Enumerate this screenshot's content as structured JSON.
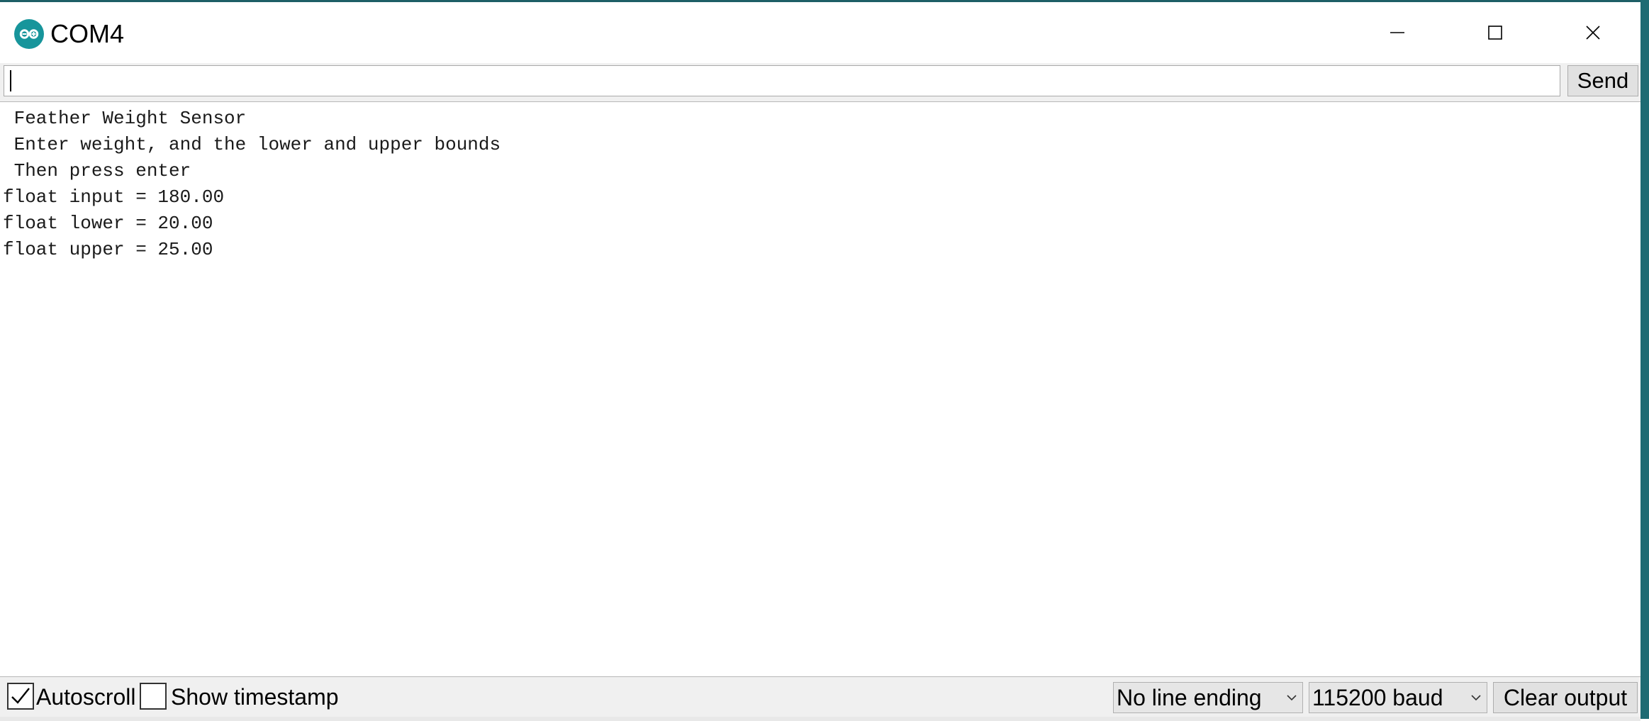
{
  "window": {
    "title": "COM4",
    "app_icon": "arduino-icon",
    "accent_color": "#1e6b73",
    "controls": {
      "minimize_icon": "minimize-icon",
      "maximize_icon": "maximize-icon",
      "close_icon": "close-icon"
    }
  },
  "send_bar": {
    "input_value": "",
    "send_label": "Send"
  },
  "output": {
    "lines": [
      " Feather Weight Sensor",
      " Enter weight, and the lower and upper bounds",
      " Then press enter",
      "float input = 180.00",
      "float lower = 20.00",
      "float upper = 25.00"
    ]
  },
  "bottom_bar": {
    "autoscroll_label": "Autoscroll",
    "autoscroll_checked": true,
    "timestamp_label": "Show timestamp",
    "timestamp_checked": false,
    "line_ending_selected": "No line ending",
    "baud_selected": "115200 baud",
    "clear_label": "Clear output"
  }
}
